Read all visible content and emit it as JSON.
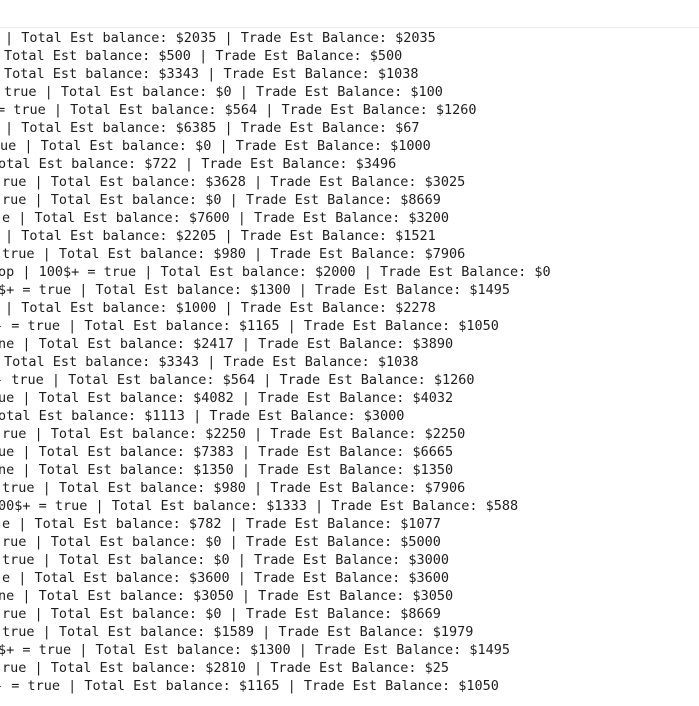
{
  "console": {
    "lines": [
      "| Total Est balance: $2035 | Trade Est Balance: $2035",
      "Total Est balance: $500 | Trade Est Balance: $500",
      "Total Est balance: $3343 | Trade Est Balance: $1038",
      "true | Total Est balance: $0 | Trade Est Balance: $100",
      "= true | Total Est balance: $564 | Trade Est Balance: $1260",
      "| Total Est balance: $6385 | Trade Est Balance: $67",
      "ue | Total Est balance: $0 | Trade Est Balance: $1000",
      "otal Est balance: $722 | Trade Est Balance: $3496",
      "rue | Total Est balance: $3628 | Trade Est Balance: $3025",
      "rue | Total Est balance: $0 | Trade Est Balance: $8669",
      "e | Total Est balance: $7600 | Trade Est Balance: $3200",
      "| Total Est balance: $2205 | Trade Est Balance: $1521",
      "true | Total Est balance: $980 | Trade Est Balance: $7906",
      "op | 100$+ = true | Total Est balance: $2000 | Trade Est Balance: $0",
      "$+ = true | Total Est balance: $1300 | Trade Est Balance: $1495",
      "| Total Est balance: $1000 | Trade Est Balance: $2278",
      "- = true | Total Est balance: $1165 | Trade Est Balance: $1050",
      "ne | Total Est balance: $2417 | Trade Est Balance: $3890",
      "Total Est balance: $3343 | Trade Est Balance: $1038",
      "- true | Total Est balance: $564 | Trade Est Balance: $1260",
      "ue | Total Est balance: $4082 | Trade Est Balance: $4032",
      "otal Est balance: $1113 | Trade Est Balance: $3000",
      "rue | Total Est balance: $2250 | Trade Est Balance: $2250",
      "ue | Total Est balance: $7383 | Trade Est Balance: $6665",
      "ne | Total Est balance: $1350 | Trade Est Balance: $1350",
      "true | Total Est balance: $980 | Trade Est Balance: $7906",
      "00$+ = true | Total Est balance: $1333 | Trade Est Balance: $588",
      "e | Total Est balance: $782 | Trade Est Balance: $1077",
      "rue | Total Est balance: $0 | Trade Est Balance: $5000",
      "true | Total Est balance: $0 | Trade Est Balance: $3000",
      "e | Total Est balance: $3600 | Trade Est Balance: $3600",
      "ne | Total Est balance: $3050 | Trade Est Balance: $3050",
      "rue | Total Est balance: $0 | Trade Est Balance: $8669",
      "true | Total Est balance: $1589 | Trade Est Balance: $1979",
      "$+ = true | Total Est balance: $1300 | Trade Est Balance: $1495",
      "rue | Total Est balance: $2810 | Trade Est Balance: $25",
      "- = true | Total Est balance: $1165 | Trade Est Balance: $1050"
    ]
  }
}
